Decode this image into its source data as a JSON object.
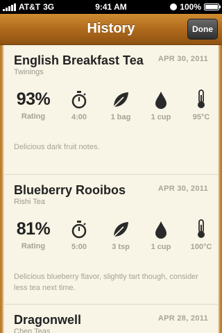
{
  "status_bar": {
    "carrier": "AT&T",
    "network": "3G",
    "time": "9:41 AM",
    "battery": "100%"
  },
  "nav": {
    "title": "History",
    "done_label": "Done"
  },
  "entries": [
    {
      "name": "English Breakfast Tea",
      "brand": "Twinings",
      "date": "APR 30, 2011",
      "rating": "93%",
      "rating_label": "Rating",
      "steep_time": "4:00",
      "amount": "1 bag",
      "water": "1 cup",
      "temp": "95°C",
      "notes": "Delicious dark fruit notes."
    },
    {
      "name": "Blueberry Rooibos",
      "brand": "Rishi Tea",
      "date": "APR 30, 2011",
      "rating": "81%",
      "rating_label": "Rating",
      "steep_time": "5:00",
      "amount": "3 tsp",
      "water": "1 cup",
      "temp": "100°C",
      "notes": "Delicious blueberry flavor, slightly tart though, consider less tea next time."
    },
    {
      "name": "Dragonwell",
      "brand": "Chen Teas",
      "date": "APR 28, 2011"
    }
  ],
  "icons": {
    "timer": "stopwatch-icon",
    "leaf": "leaf-icon",
    "water": "water-drop-icon",
    "temp": "thermometer-icon"
  },
  "colors": {
    "nav_accent": "#b06a1c",
    "card_bg": "#f8f4e6",
    "muted_text": "#a8a290"
  }
}
